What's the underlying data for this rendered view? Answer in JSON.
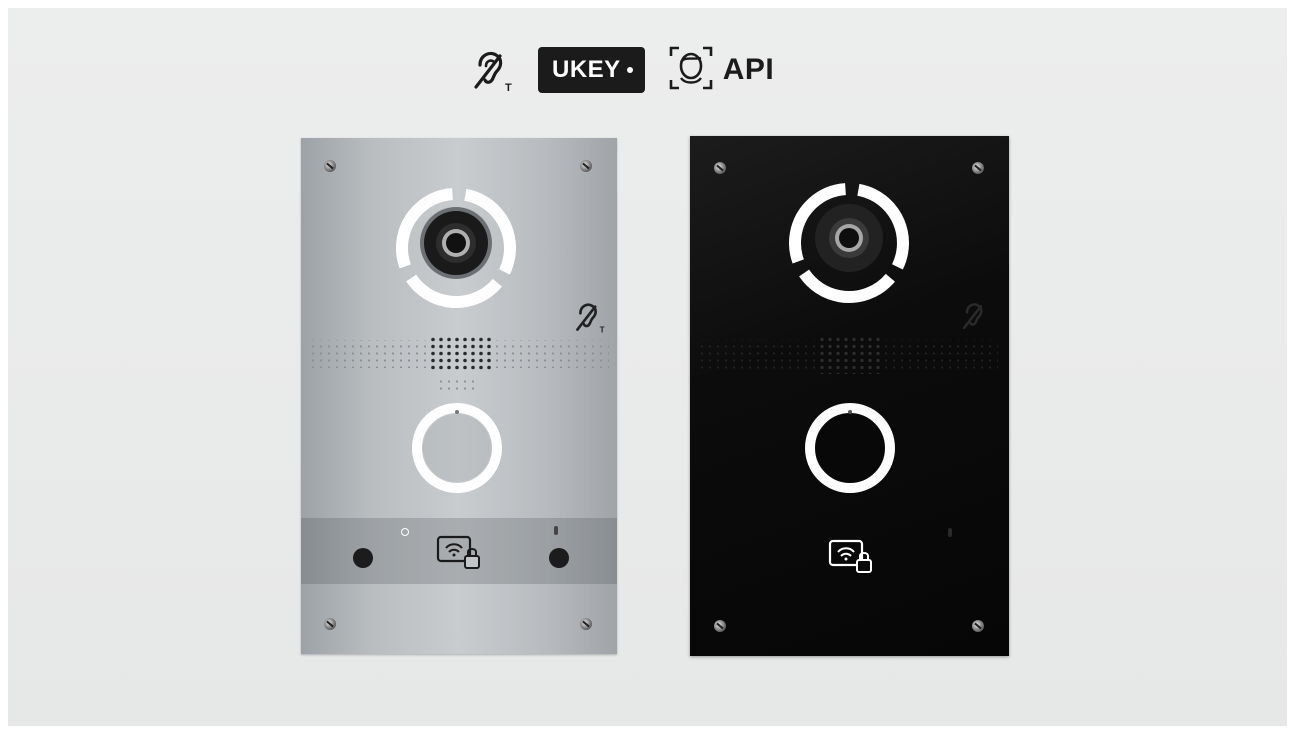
{
  "features": {
    "ukey_label": "UKEY",
    "api_label": "API",
    "icons": [
      "hearing-loop-icon",
      "ukey-icon",
      "face-recognition-icon"
    ]
  },
  "panels": [
    {
      "finish": "silver",
      "color": "#b9bdc0"
    },
    {
      "finish": "black",
      "color": "#0c0c0c"
    }
  ],
  "colors": {
    "background": "#eaebeb",
    "icon": "#1b1b1b",
    "ring": "#ffffff"
  }
}
